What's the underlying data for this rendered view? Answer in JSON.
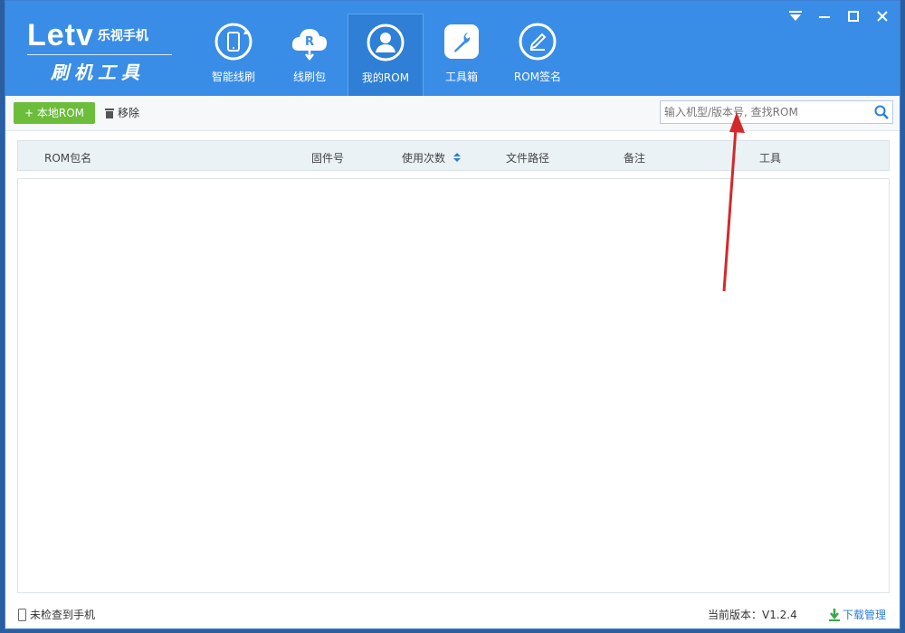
{
  "logo": {
    "brand": "Letv",
    "brand_sub": "乐视手机",
    "tool": "刷机工具"
  },
  "nav": [
    {
      "label": "智能线刷",
      "icon": "phone-refresh-icon"
    },
    {
      "label": "线刷包",
      "icon": "cloud-download-icon"
    },
    {
      "label": "我的ROM",
      "icon": "user-icon"
    },
    {
      "label": "工具箱",
      "icon": "wrench-icon"
    },
    {
      "label": "ROM签名",
      "icon": "pen-icon"
    }
  ],
  "window_controls": [
    "menu-icon",
    "minimize-icon",
    "maximize-icon",
    "close-icon"
  ],
  "toolbar": {
    "add_label": "+ 本地ROM",
    "remove_label": "移除",
    "search_placeholder": "输入机型/版本号, 查找ROM"
  },
  "table": {
    "columns": [
      "ROM包名",
      "固件号",
      "使用次数",
      "文件路径",
      "备注",
      "工具"
    ],
    "rows": []
  },
  "status": {
    "phone": "未检查到手机",
    "version": "当前版本：V1.2.4",
    "download": "下载管理"
  },
  "colors": {
    "header": "#3a8de6",
    "accent_green": "#6bbd3a",
    "link": "#2a7fd6",
    "arrow": "#d22a2a"
  }
}
